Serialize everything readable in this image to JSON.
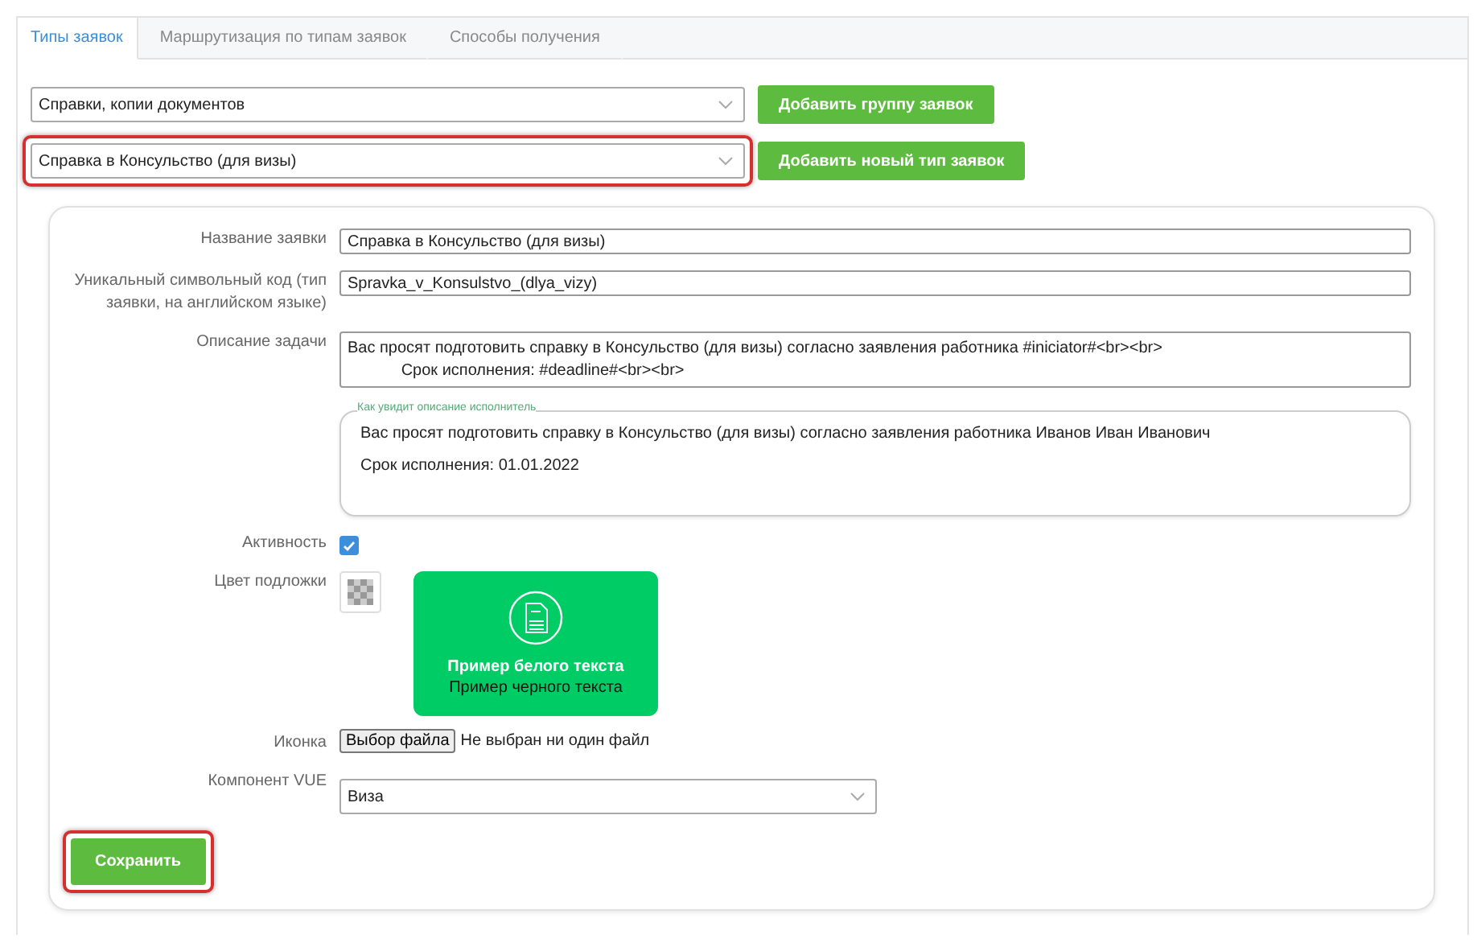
{
  "tabs": [
    {
      "label": "Типы заявок",
      "selected": true
    },
    {
      "label": "Маршрутизация по типам заявок",
      "selected": false
    },
    {
      "label": "Способы получения",
      "selected": false
    }
  ],
  "selectors": [
    {
      "value": "Справки, копии документов",
      "button": "Добавить группу заявок",
      "highlighted": false
    },
    {
      "value": "Справка в Консульство (для визы)",
      "button": "Добавить новый тип заявок",
      "highlighted": true
    }
  ],
  "form": {
    "name": {
      "label": "Название заявки",
      "value": "Справка в Консульство (для визы)"
    },
    "code": {
      "label": "Уникальный символьный код (тип заявки, на английском языке)",
      "value": "Spravka_v_Konsulstvo_(dlya_vizy)"
    },
    "description": {
      "label": "Описание задачи",
      "lines": [
        "Вас просят подготовить справку в Консульство (для визы) согласно заявления работника #iniciator#<br><br>",
        "            Срок исполнения: #deadline#<br><br>"
      ]
    },
    "preview": {
      "legend": "Как увидит описание исполнитель",
      "lines": [
        "Вас просят подготовить справку в Консульство (для визы) согласно заявления работника Иванов Иван Иванович",
        "Срок исполнения: 01.01.2022"
      ]
    },
    "active": {
      "label": "Активность",
      "checked": true
    },
    "background": {
      "label": "Цвет подложки",
      "color": "#00cc66",
      "white_text": "Пример белого текста",
      "black_text": "Пример черного текста"
    },
    "icon": {
      "label": "Иконка",
      "button": "Выбор файла",
      "status": "Не выбран ни один файл"
    },
    "component": {
      "label": "Компонент VUE",
      "value": "Виза"
    },
    "save": {
      "label": "Сохранить",
      "highlighted": true
    }
  }
}
